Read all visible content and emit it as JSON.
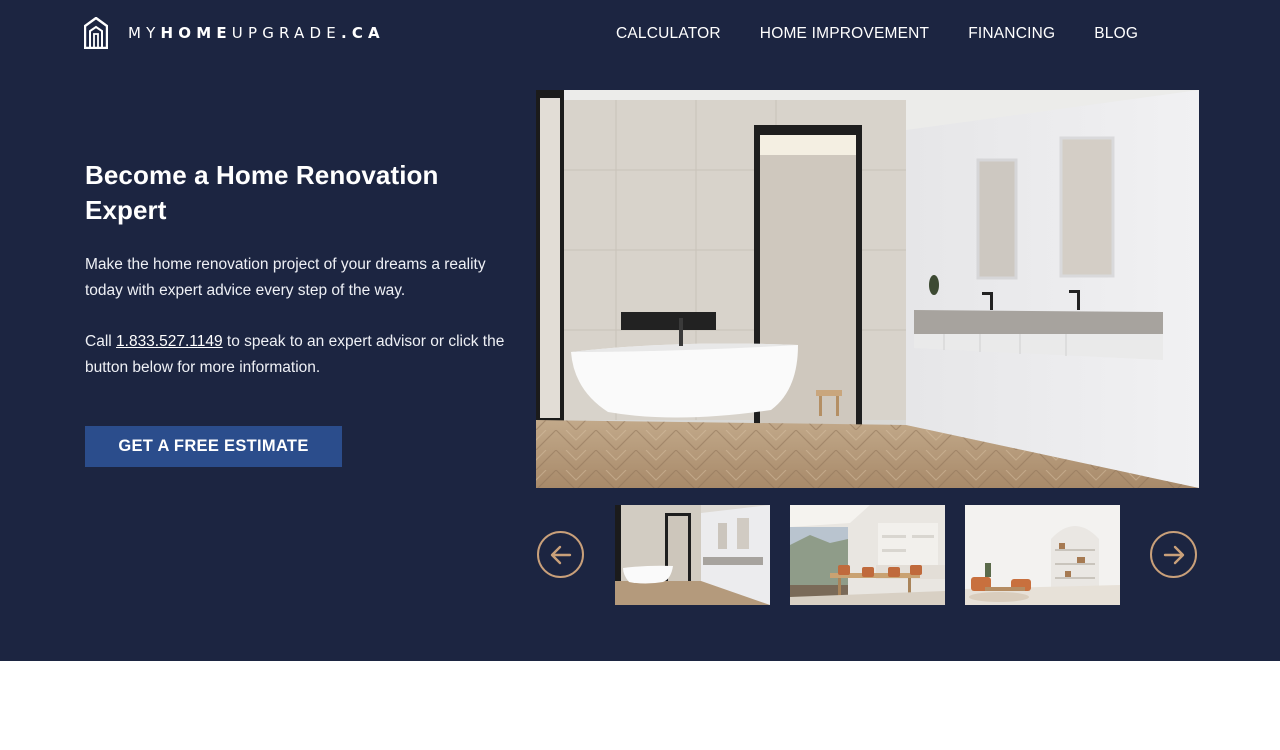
{
  "header": {
    "logo": {
      "icon": "house-logo-icon",
      "text_light_1": "MY",
      "text_bold_1": "HOME",
      "text_light_2": "UPGRADE",
      "text_bold_2": ".CA"
    },
    "nav": [
      {
        "label": "CALCULATOR"
      },
      {
        "label": "HOME IMPROVEMENT"
      },
      {
        "label": "FINANCING"
      },
      {
        "label": "BLOG"
      }
    ]
  },
  "hero": {
    "headline": "Become a Home Renovation Expert",
    "intro": "Make the home renovation project of your dreams a reality today with expert advice every step of the way.",
    "call_prefix": "Call ",
    "phone": "1.833.527.1149",
    "call_suffix": " to speak to an expert advisor or click the button below for more information.",
    "cta_label": "GET A FREE ESTIMATE"
  },
  "gallery": {
    "main_image": "bathroom-photo",
    "thumbnails": [
      {
        "image": "bathroom-thumbnail"
      },
      {
        "image": "dining-room-thumbnail"
      },
      {
        "image": "living-room-thumbnail"
      }
    ],
    "prev_icon": "arrow-left-icon",
    "next_icon": "arrow-right-icon"
  },
  "colors": {
    "hero_background": "#1c2541",
    "cta_background": "#2b4d8c",
    "arrow_accent": "#c9a07a",
    "page_background": "#ffffff"
  }
}
